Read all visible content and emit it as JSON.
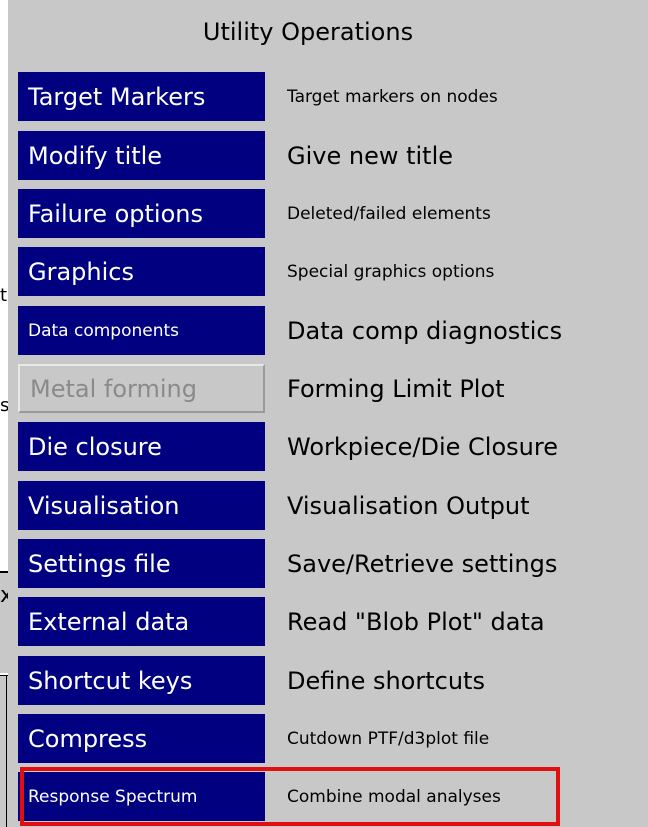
{
  "panel": {
    "title": "Utility Operations"
  },
  "items": [
    {
      "button": "Target Markers",
      "description": "Target markers on nodes",
      "enabled": true
    },
    {
      "button": "Modify title",
      "description": "Give new title",
      "enabled": true
    },
    {
      "button": "Failure options",
      "description": "Deleted/failed elements",
      "enabled": true
    },
    {
      "button": "Graphics",
      "description": "Special graphics options",
      "enabled": true
    },
    {
      "button": "Data components",
      "description": "Data comp diagnostics",
      "enabled": true
    },
    {
      "button": "Metal forming",
      "description": "Forming Limit Plot",
      "enabled": false
    },
    {
      "button": "Die closure",
      "description": "Workpiece/Die Closure",
      "enabled": true
    },
    {
      "button": "Visualisation",
      "description": "Visualisation Output",
      "enabled": true
    },
    {
      "button": "Settings file",
      "description": "Save/Retrieve settings",
      "enabled": true
    },
    {
      "button": "External data",
      "description": "Read \"Blob Plot\" data",
      "enabled": true
    },
    {
      "button": "Shortcut keys",
      "description": "Define shortcuts",
      "enabled": true
    },
    {
      "button": "Compress",
      "description": "Cutdown PTF/d3plot file",
      "enabled": true
    },
    {
      "button": "Response Spectrum",
      "description": "Combine modal analyses",
      "enabled": true,
      "highlighted": true
    }
  ],
  "colors": {
    "panel_bg": "#c8c8c8",
    "button_bg": "#000080",
    "button_text": "#ffffff",
    "disabled_text": "#8a8a8a",
    "highlight_border": "#e01010"
  }
}
